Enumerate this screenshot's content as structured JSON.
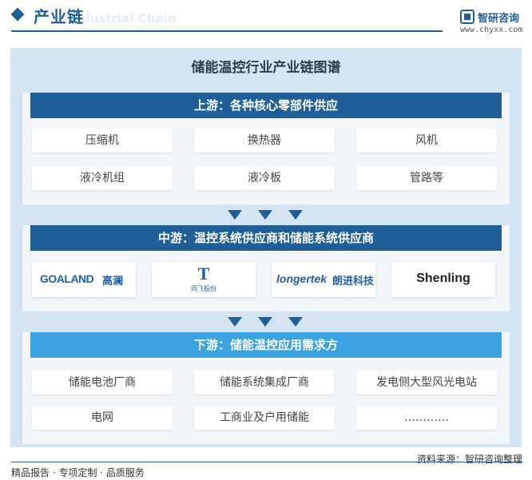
{
  "header": {
    "title": "产业链",
    "title_en": "Industrial Chain",
    "logo_name": "智研咨询",
    "logo_url": "www.chyxx.com",
    "brand_color": "#1f5e96"
  },
  "main_title": "储能温控行业产业链图谱",
  "upstream": {
    "title": "上游：各种核心零部件供应",
    "items": [
      "压缩机",
      "换热器",
      "风机",
      "液冷机组",
      "液冷板",
      "管路等"
    ]
  },
  "midstream": {
    "title": "中游：温控系统供应商和储能系统供应商",
    "logos": [
      {
        "name": "goaland-logo",
        "text": "GOALAND",
        "cn": "高澜"
      },
      {
        "name": "tongfei-logo",
        "text": "T",
        "cn": "同飞股份"
      },
      {
        "name": "longertek-logo",
        "text": "longertek",
        "cn": "朗进科技"
      },
      {
        "name": "shenling-logo",
        "text": "Shenling"
      }
    ]
  },
  "downstream": {
    "title": "下游：储能温控应用需求方",
    "items": [
      "储能电池厂商",
      "储能系统集成厂商",
      "发电侧大型风光电站",
      "电网",
      "工商业及户用储能",
      "…………"
    ]
  },
  "footer": {
    "left": "精品报告 · 专项定制 · 品质服务",
    "source": "资料来源：智研咨询整理"
  }
}
